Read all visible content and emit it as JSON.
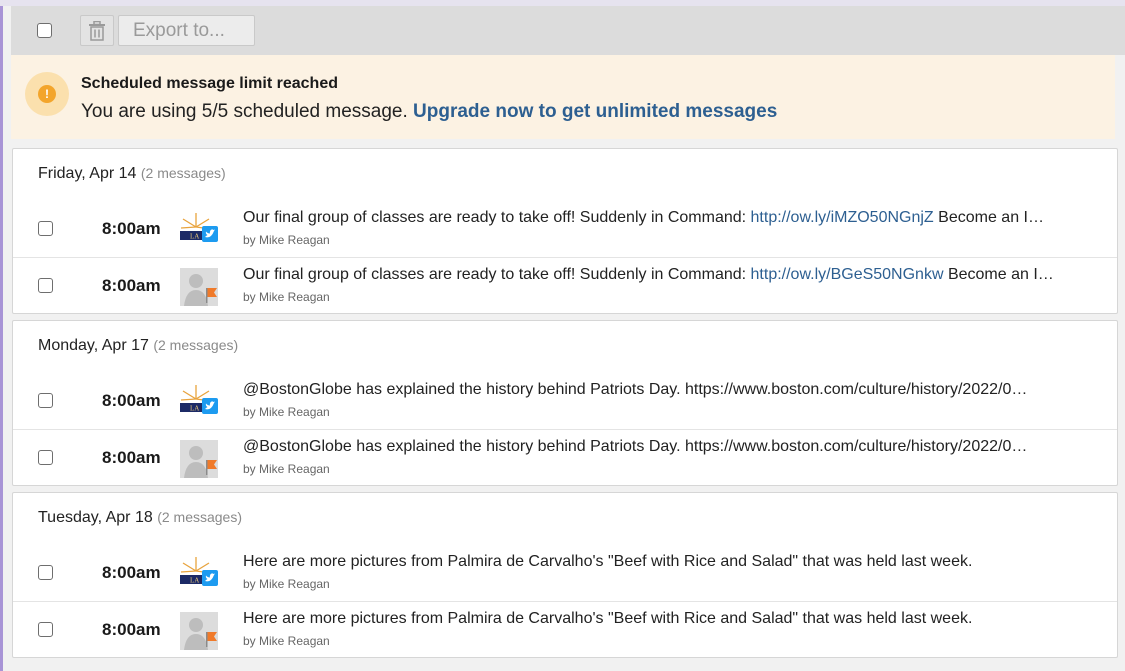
{
  "toolbar": {
    "export_label": "Export to..."
  },
  "banner": {
    "title": "Scheduled message limit reached",
    "text": "You are using 5/5 scheduled message.",
    "link": "Upgrade now to get unlimited messages"
  },
  "groups": [
    {
      "date": "Friday, Apr 14",
      "count": "(2 messages)",
      "rows": [
        {
          "time": "8:00am",
          "avatar": "twitter-logo",
          "pre": "Our final group of classes are ready to take off! Suddenly in Command: ",
          "link": "http://ow.ly/iMZO50NGnjZ",
          "post": " Become an I…",
          "by": "by Mike Reagan"
        },
        {
          "time": "8:00am",
          "avatar": "facebook-generic",
          "pre": "Our final group of classes are ready to take off! Suddenly in Command: ",
          "link": "http://ow.ly/BGeS50NGnkw",
          "post": " Become an I…",
          "by": "by Mike Reagan"
        }
      ]
    },
    {
      "date": "Monday, Apr 17",
      "count": "(2 messages)",
      "rows": [
        {
          "time": "8:00am",
          "avatar": "twitter-logo",
          "pre": "@BostonGlobe has explained the history behind Patriots Day. https://www.boston.com/culture/history/2022/0…",
          "link": "",
          "post": "",
          "by": "by Mike Reagan"
        },
        {
          "time": "8:00am",
          "avatar": "facebook-generic",
          "pre": "@BostonGlobe has explained the history behind Patriots Day. https://www.boston.com/culture/history/2022/0…",
          "link": "",
          "post": "",
          "by": "by Mike Reagan"
        }
      ]
    },
    {
      "date": "Tuesday, Apr 18",
      "count": "(2 messages)",
      "rows": [
        {
          "time": "8:00am",
          "avatar": "twitter-logo",
          "pre": "Here are more pictures from Palmira de Carvalho's \"Beef with Rice and Salad\" that was held last week.",
          "link": "",
          "post": "",
          "by": "by Mike Reagan"
        },
        {
          "time": "8:00am",
          "avatar": "facebook-generic",
          "pre": "Here are more pictures from Palmira de Carvalho's \"Beef with Rice and Salad\" that was held last week.",
          "link": "",
          "post": "",
          "by": "by Mike Reagan"
        }
      ]
    }
  ],
  "colors": {
    "link": "#2d5f91",
    "banner_bg": "#fcf2e3",
    "warning": "#f3a52b",
    "twitter": "#1d9bf0",
    "facebook_flag": "#f07a2a"
  }
}
